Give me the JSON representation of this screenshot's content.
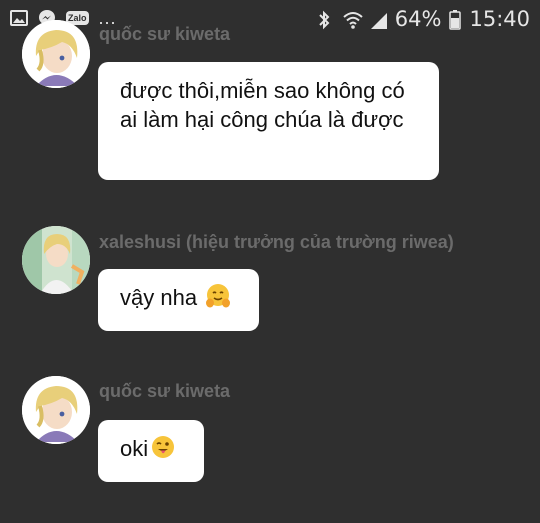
{
  "status_bar": {
    "zalo_label": "Zalo",
    "more_indicator": "...",
    "battery_percent": "64%",
    "time": "15:40",
    "left_icons": [
      "gallery-icon",
      "messenger-icon",
      "zalo-icon"
    ],
    "right_icons": [
      "bluetooth-icon",
      "wifi-icon",
      "signal-icon",
      "battery-icon"
    ]
  },
  "messages": [
    {
      "sender": "quốc sư kiweta",
      "text": "được thôi,miễn sao không có ai làm hại công chúa là được",
      "emoji": ""
    },
    {
      "sender": "xaleshusi (hiệu trưởng của trường riwea)",
      "text": "vậy nha",
      "emoji": "hugging-face-emoji"
    },
    {
      "sender": "quốc sư kiweta",
      "text": "oki",
      "emoji": "winking-tongue-face-emoji"
    }
  ],
  "colors": {
    "background": "#2f2f2f",
    "bubble": "#ffffff",
    "sender_name": "#6b6b6b",
    "status_text": "#e6e6e6"
  }
}
